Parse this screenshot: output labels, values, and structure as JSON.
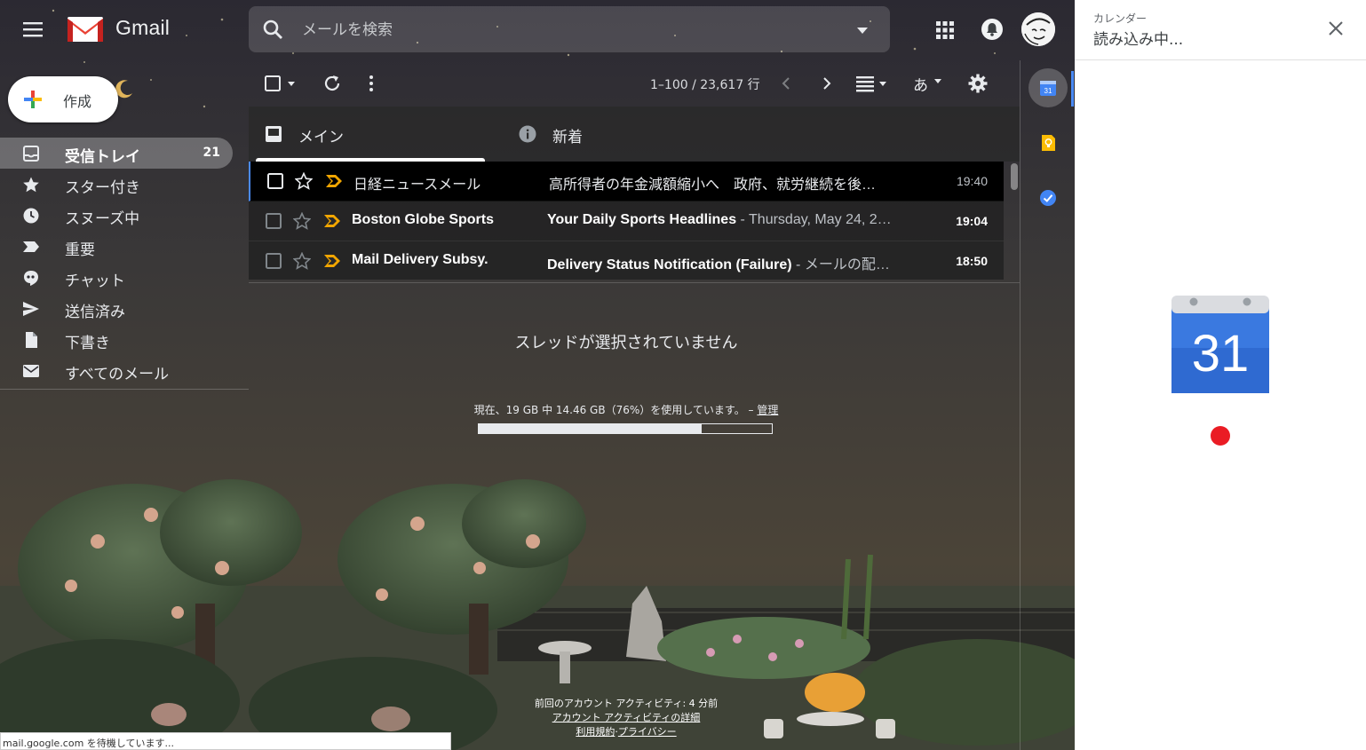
{
  "app": {
    "name": "Gmail",
    "colors": {
      "accent": "#4a8af4",
      "gmail_red": "#ea4335",
      "loading_dot": "#ea1c24"
    }
  },
  "header": {
    "logo_text": "Gmail",
    "search_placeholder": "メールを検索",
    "icons": [
      "menu-icon",
      "gmail-logo",
      "search-icon",
      "search-options-icon",
      "apps-grid-icon",
      "notifications-icon",
      "avatar"
    ]
  },
  "compose": {
    "label": "作成"
  },
  "sidebar": {
    "items": [
      {
        "label": "受信トレイ",
        "count": "21",
        "icon": "inbox-icon",
        "active": true
      },
      {
        "label": "スター付き",
        "icon": "star-icon"
      },
      {
        "label": "スヌーズ中",
        "icon": "clock-icon"
      },
      {
        "label": "重要",
        "icon": "important-label-icon"
      },
      {
        "label": "チャット",
        "icon": "chat-icon"
      },
      {
        "label": "送信済み",
        "icon": "send-icon"
      },
      {
        "label": "下書き",
        "icon": "draft-file-icon"
      },
      {
        "label": "すべてのメール",
        "icon": "mail-envelope-icon"
      }
    ]
  },
  "toolbar": {
    "page_count": "1–100 / 23,617 行",
    "icons": [
      "select-checkbox-icon",
      "refresh-icon",
      "more-vert-icon",
      "prev-page-icon",
      "next-page-icon",
      "density-icon",
      "input-tools-icon",
      "settings-gear-icon"
    ],
    "input_tools_label": "あ"
  },
  "tabs": [
    {
      "label": "メイン",
      "icon": "inbox-tab-icon",
      "active": true
    },
    {
      "label": "新着",
      "icon": "info-icon"
    }
  ],
  "emails": [
    {
      "sender": "日経ニュースメール",
      "subject": "高所得者の年金減額縮小へ　政府、就労継続を後…",
      "snippet": "",
      "time": "19:40",
      "unread": false,
      "selected": true
    },
    {
      "sender": "Boston Globe Sports",
      "subject": "Your Daily Sports Headlines",
      "snippet": " - Thursday, May 24, 2…",
      "time": "19:04",
      "unread": true,
      "selected": false
    },
    {
      "sender": "Mail Delivery Subsy.",
      "subject": "Delivery Status Notification (Failure)",
      "snippet": " - メールの配…",
      "time": "18:50",
      "unread": true,
      "selected": false
    }
  ],
  "reading_pane": {
    "no_thread": "スレッドが選択されていません",
    "storage_text": "現在、19 GB 中 14.46 GB（76%）を使用しています。 – ",
    "storage_manage": "管理",
    "storage_used_fraction": 0.76
  },
  "footer": {
    "last_activity": "前回のアカウント アクティビティ: 4 分前",
    "activity_details": "アカウント アクティビティの詳細",
    "terms": "利用規約",
    "separator": "·",
    "privacy": "プライバシー"
  },
  "status_bar": {
    "text": "mail.google.com を待機しています..."
  },
  "rail": {
    "icons": [
      "calendar-addon-icon",
      "keep-addon-icon",
      "tasks-addon-icon"
    ]
  },
  "side_panel": {
    "title": "カレンダー",
    "subtitle": "読み込み中...",
    "calendar_day": "31"
  }
}
